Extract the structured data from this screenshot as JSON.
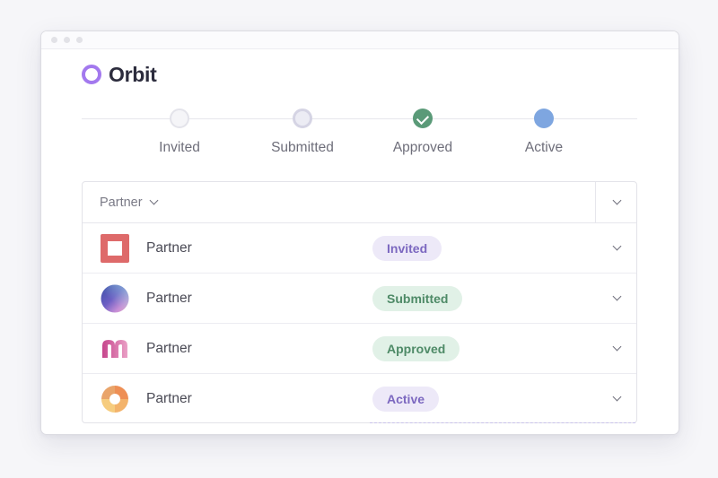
{
  "app": {
    "name": "Orbit",
    "accent_color": "#a379ee"
  },
  "stepper": {
    "steps": [
      {
        "label": "Invited",
        "state": "pending",
        "color": "#e3e3ea"
      },
      {
        "label": "Submitted",
        "state": "pending",
        "color": "#d5d4e4"
      },
      {
        "label": "Approved",
        "state": "complete",
        "color": "#5a9a78",
        "icon": "check-icon"
      },
      {
        "label": "Active",
        "state": "current",
        "color": "#7ea6e0"
      }
    ]
  },
  "table": {
    "header": {
      "column_label": "Partner",
      "column_icon": "chevron-down-icon",
      "expand_icon": "chevron-down-icon"
    },
    "rows": [
      {
        "name": "Partner",
        "status": "Invited",
        "logo_icon": "red-square-logo-icon",
        "status_color": "#7c68c0"
      },
      {
        "name": "Partner",
        "status": "Submitted",
        "logo_icon": "gradient-sphere-logo-icon",
        "status_color": "#4e8a67"
      },
      {
        "name": "Partner",
        "status": "Approved",
        "logo_icon": "pink-m-logo-icon",
        "status_color": "#4e8a67"
      },
      {
        "name": "Partner",
        "status": "Active",
        "logo_icon": "orange-swirl-logo-icon",
        "status_color": "#7c68c0"
      }
    ]
  }
}
